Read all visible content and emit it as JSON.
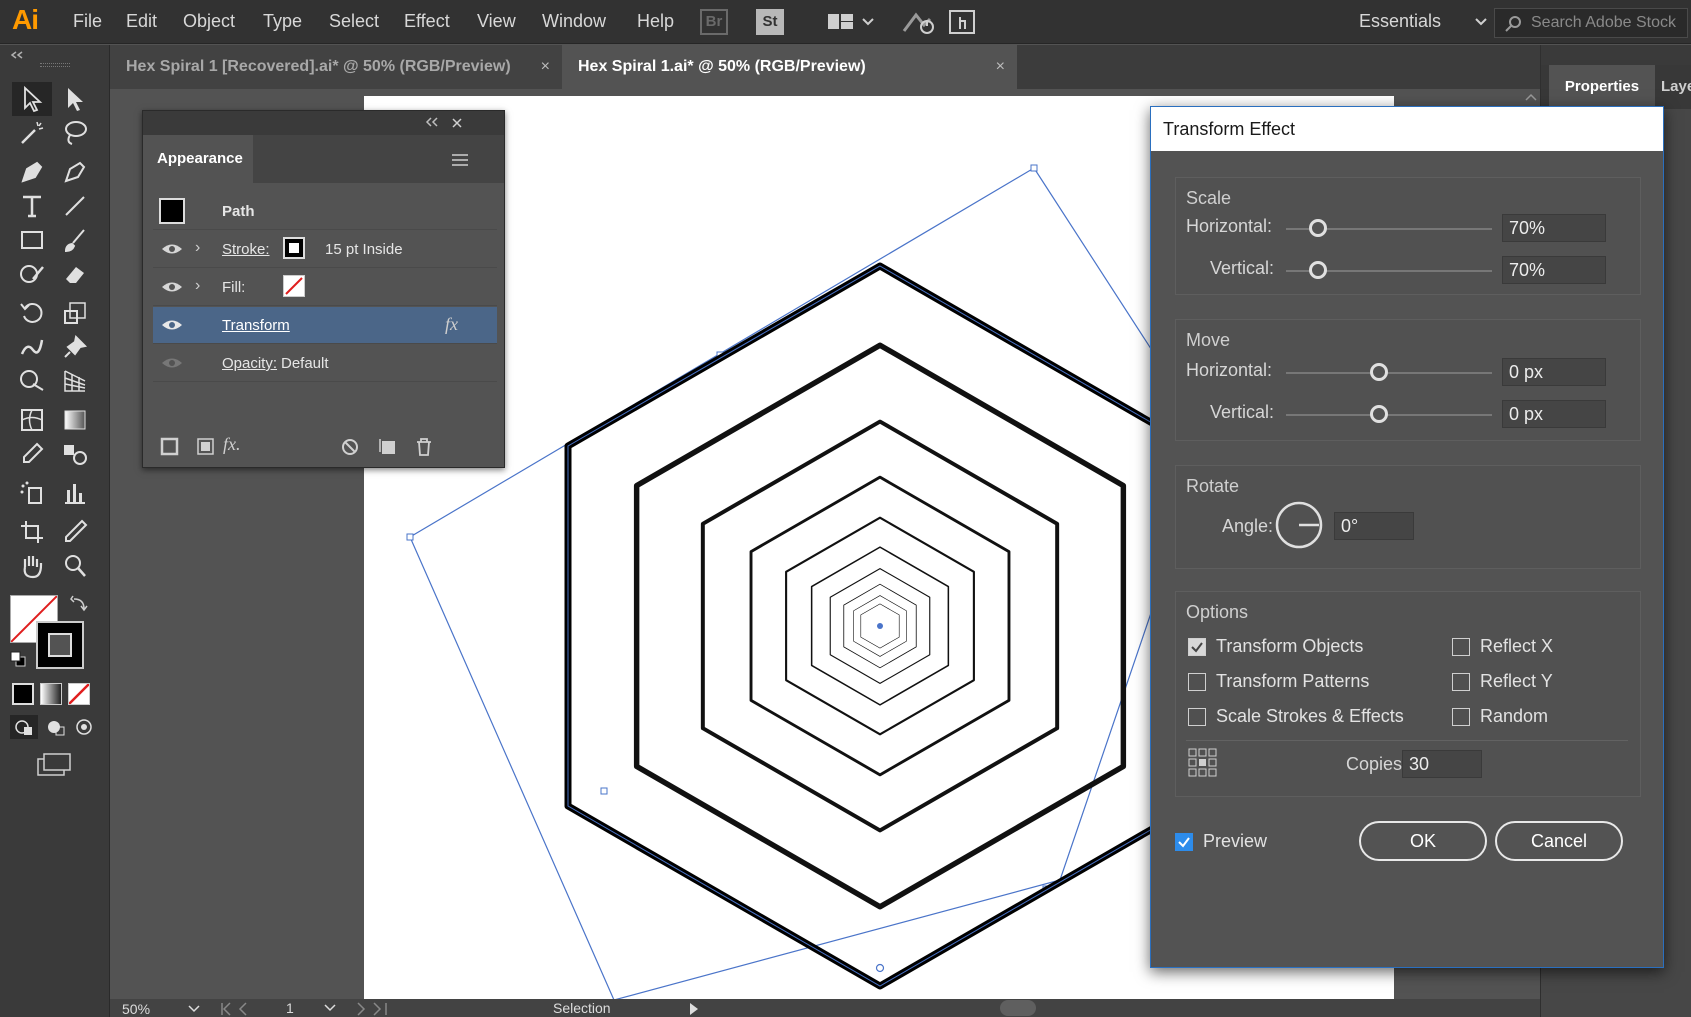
{
  "app": {
    "logo": "Ai"
  },
  "menu": [
    "File",
    "Edit",
    "Object",
    "Type",
    "Select",
    "Effect",
    "View",
    "Window",
    "Help"
  ],
  "menubar_icons": {
    "bridge": "Br",
    "stock": "St"
  },
  "workspace": {
    "label": "Essentials"
  },
  "search": {
    "placeholder": "Search Adobe Stock"
  },
  "tabs": [
    {
      "label": "Hex Spiral 1 [Recovered].ai* @ 50% (RGB/Preview)",
      "close": "×"
    },
    {
      "label": "Hex Spiral 1.ai* @ 50% (RGB/Preview)",
      "close": "×"
    }
  ],
  "properties_panel": {
    "tab": "Properties",
    "layers_tab": "Layers"
  },
  "appearance": {
    "tab": "Appearance",
    "object": "Path",
    "stroke": {
      "label": "Stroke:",
      "value": "15 pt  Inside"
    },
    "fill": {
      "label": "Fill:"
    },
    "effect": {
      "label": "Transform",
      "fx": "fx"
    },
    "opacity": {
      "label": "Opacity:",
      "value": "Default"
    },
    "footer_fx": "fx."
  },
  "dialog": {
    "title": "Transform Effect",
    "scale": {
      "title": "Scale",
      "horizontal_label": "Horizontal:",
      "horizontal_value": "70%",
      "horizontal_pct": 0.7,
      "vertical_label": "Vertical:",
      "vertical_value": "70%",
      "vertical_pct": 0.7
    },
    "move": {
      "title": "Move",
      "horizontal_label": "Horizontal:",
      "horizontal_value": "0 px",
      "vertical_label": "Vertical:",
      "vertical_value": "0 px"
    },
    "rotate": {
      "title": "Rotate",
      "angle_label": "Angle:",
      "angle_value": "0°"
    },
    "options": {
      "title": "Options",
      "transform_objects": {
        "label": "Transform Objects",
        "checked": true
      },
      "transform_patterns": {
        "label": "Transform Patterns",
        "checked": false
      },
      "scale_strokes": {
        "label": "Scale Strokes & Effects",
        "checked": false
      },
      "reflect_x": {
        "label": "Reflect X",
        "checked": false
      },
      "reflect_y": {
        "label": "Reflect Y",
        "checked": false
      },
      "random": {
        "label": "Random",
        "checked": false
      },
      "copies_label": "Copies",
      "copies_value": "30"
    },
    "preview": {
      "label": "Preview",
      "checked": true
    },
    "ok": "OK",
    "cancel": "Cancel"
  },
  "status": {
    "zoom": "50%",
    "artboard": "1",
    "mode": "Selection"
  },
  "colors": {
    "accent": "#2d8ceb",
    "selection": "#4a74c9",
    "app_orange": "#ff9a00"
  }
}
